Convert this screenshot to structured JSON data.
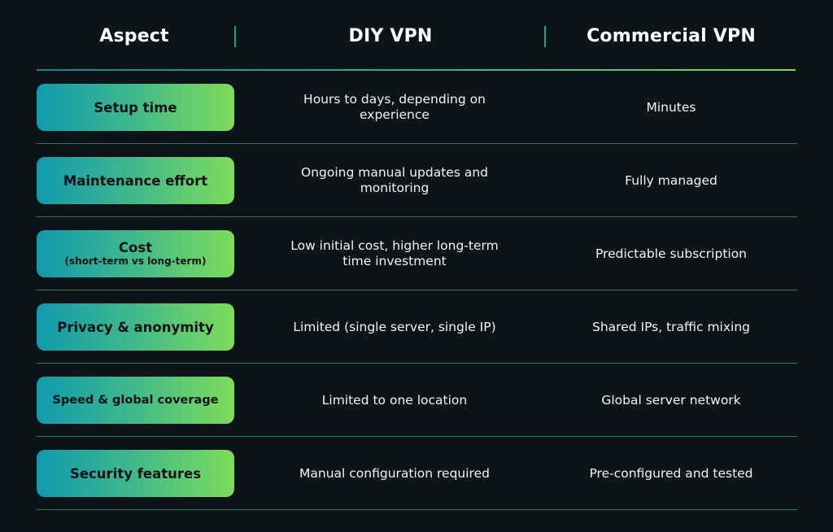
{
  "header": {
    "aspect": "Aspect",
    "diy": "DIY VPN",
    "commercial": "Commercial VPN"
  },
  "colors": {
    "background": "#0d1418",
    "pill_gradient_start": "#109aae",
    "pill_gradient_end": "#7edc5a",
    "separator": "#2a7a5a"
  },
  "rows": [
    {
      "aspect": "Setup time",
      "aspect_sub": "",
      "diy": "Hours to days, depending on experience",
      "commercial": "Minutes"
    },
    {
      "aspect": "Maintenance effort",
      "aspect_sub": "",
      "diy": "Ongoing manual updates and monitoring",
      "commercial": "Fully managed"
    },
    {
      "aspect": "Cost",
      "aspect_sub": "(short-term vs long-term)",
      "diy": "Low initial cost, higher long-term time investment",
      "commercial": "Predictable subscription"
    },
    {
      "aspect": "Privacy & anonymity",
      "aspect_sub": "",
      "diy": "Limited (single server, single IP)",
      "commercial": "Shared IPs, traffic mixing"
    },
    {
      "aspect": "Speed & global coverage",
      "aspect_sub": "",
      "diy": "Limited to one location",
      "commercial": "Global server network"
    },
    {
      "aspect": "Security features",
      "aspect_sub": "",
      "diy": "Manual configuration required",
      "commercial": "Pre-configured and tested"
    }
  ]
}
